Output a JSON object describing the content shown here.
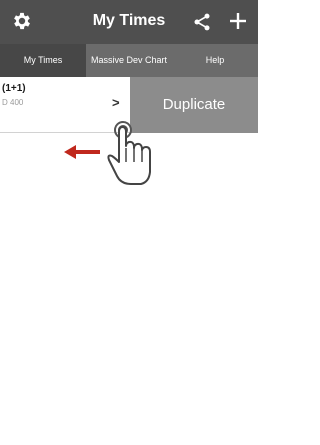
{
  "header": {
    "title": "My Times",
    "icons": [
      "gear-icon",
      "share-icon",
      "plus-icon"
    ]
  },
  "tabs": [
    {
      "label": "My Times",
      "active": true
    },
    {
      "label": "Massive Dev Chart",
      "active": false
    },
    {
      "label": "Help",
      "active": false
    }
  ],
  "list": {
    "items": [
      {
        "title": "(1+1)",
        "subtitle": "D 400",
        "chevron": ">"
      }
    ]
  },
  "swipe_action": {
    "label": "Duplicate"
  },
  "colors": {
    "topbar": "#4f4f4f",
    "tab_active": "#474747",
    "tab_bg": "#6b6b6b",
    "duplicate_bg": "#8c8c8c",
    "arrow": "#c0281d"
  },
  "overlay": {
    "icons": [
      "swipe-left-arrow-icon",
      "hand-pointer-icon"
    ]
  }
}
